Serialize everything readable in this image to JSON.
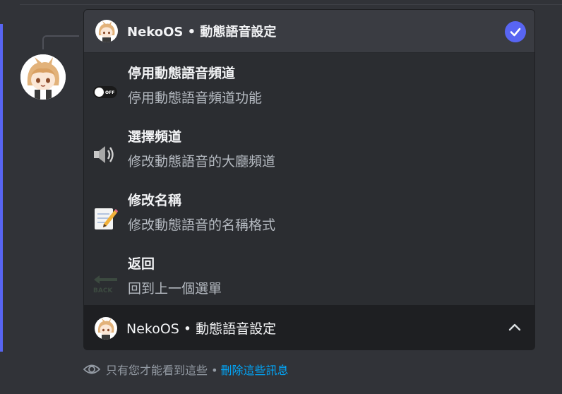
{
  "dropdown": {
    "title": "NekoOS • 動態語音設定",
    "options": [
      {
        "label": "停用動態語音頻道",
        "desc": "停用動態語音頻道功能",
        "icon": "toggle-off-icon",
        "icon_text": "OFF"
      },
      {
        "label": "選擇頻道",
        "desc": "修改動態語音的大廳頻道",
        "icon": "speaker-icon"
      },
      {
        "label": "修改名稱",
        "desc": "修改動態語音的名稱格式",
        "icon": "memo-icon"
      },
      {
        "label": "返回",
        "desc": "回到上一個選單",
        "icon": "back-arrow-icon",
        "icon_text": "BACK"
      }
    ]
  },
  "select_menu": {
    "value": "NekoOS • 動態語音設定"
  },
  "footer": {
    "notice": "只有您才能看到這些 •",
    "dismiss_link": "刪除這些訊息"
  },
  "colors": {
    "accent": "#5865f2",
    "link": "#00a8fc",
    "background": "#313338"
  }
}
